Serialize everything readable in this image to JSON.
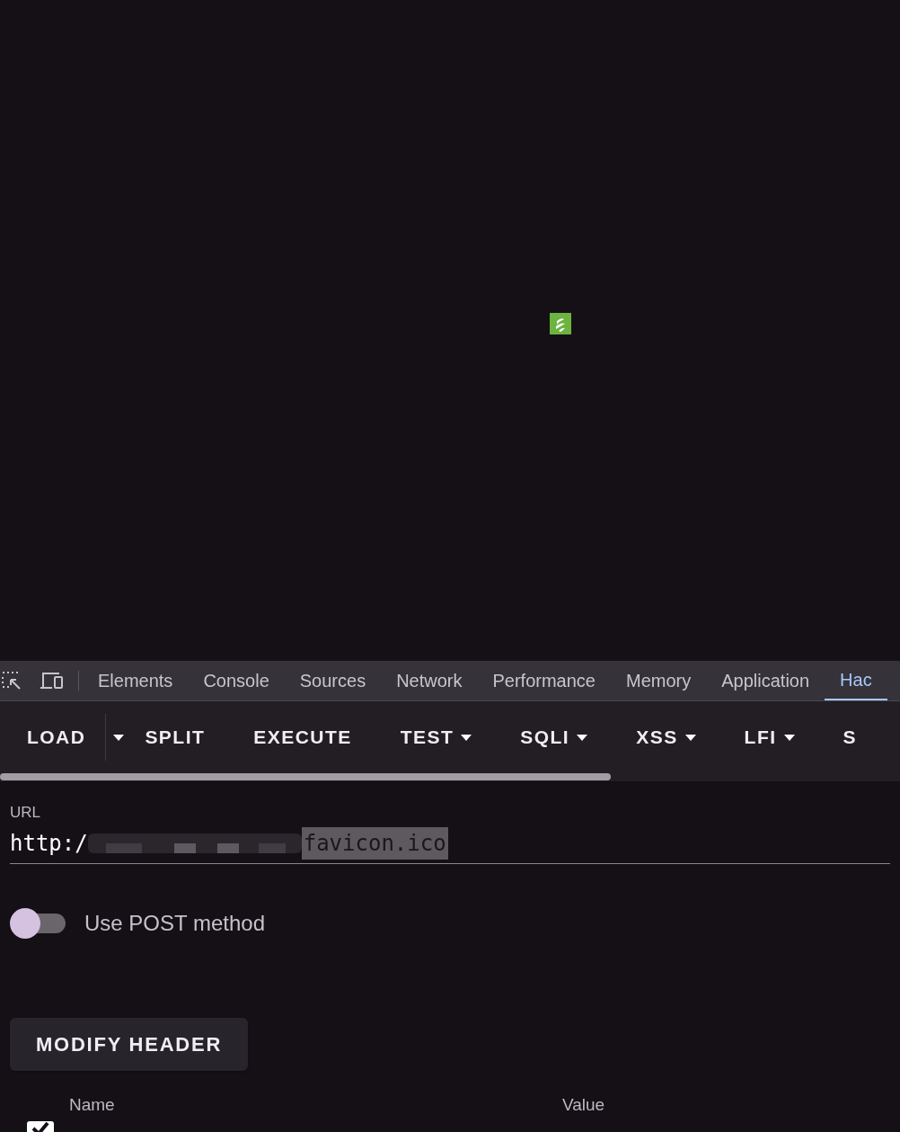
{
  "devtools_tabs": [
    {
      "label": "Elements",
      "selected": false
    },
    {
      "label": "Console",
      "selected": false
    },
    {
      "label": "Sources",
      "selected": false
    },
    {
      "label": "Network",
      "selected": false
    },
    {
      "label": "Performance",
      "selected": false
    },
    {
      "label": "Memory",
      "selected": false
    },
    {
      "label": "Application",
      "selected": false
    },
    {
      "label": "Hac",
      "selected": true
    }
  ],
  "toolbar": [
    {
      "label": "LOAD",
      "kind": "split"
    },
    {
      "label": "SPLIT",
      "kind": "plain"
    },
    {
      "label": "EXECUTE",
      "kind": "plain"
    },
    {
      "label": "TEST",
      "kind": "menu"
    },
    {
      "label": "SQLI",
      "kind": "menu"
    },
    {
      "label": "XSS",
      "kind": "menu"
    },
    {
      "label": "LFI",
      "kind": "menu"
    },
    {
      "label": "S",
      "kind": "plain"
    }
  ],
  "url": {
    "label": "URL",
    "value_start": "http:/",
    "value_selected": "favicon.ico"
  },
  "post_toggle": {
    "label": "Use POST method",
    "on": false
  },
  "modify_header_button": "MODIFY HEADER",
  "headers_table": {
    "columns": [
      "Name",
      "Value"
    ],
    "rows": [
      {
        "checked": true
      }
    ]
  }
}
